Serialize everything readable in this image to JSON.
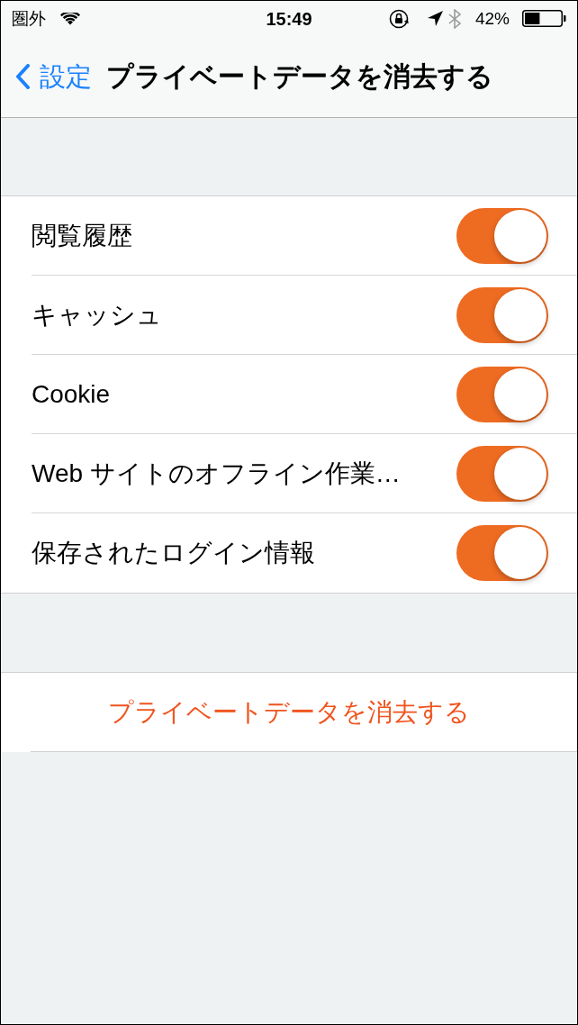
{
  "status_bar": {
    "carrier": "圏外",
    "time": "15:49",
    "battery": "42%"
  },
  "nav_bar": {
    "back": "設定",
    "title": "プライベートデータを消去する"
  },
  "toggles": [
    {
      "label": "閲覧履歴",
      "on": true
    },
    {
      "label": "キャッシュ",
      "on": true
    },
    {
      "label": "Cookie",
      "on": true
    },
    {
      "label": "Web サイトのオフライン作業…",
      "on": true
    },
    {
      "label": "保存されたログイン情報",
      "on": true
    }
  ],
  "clear_button": {
    "label": "プライベートデータを消去する"
  }
}
